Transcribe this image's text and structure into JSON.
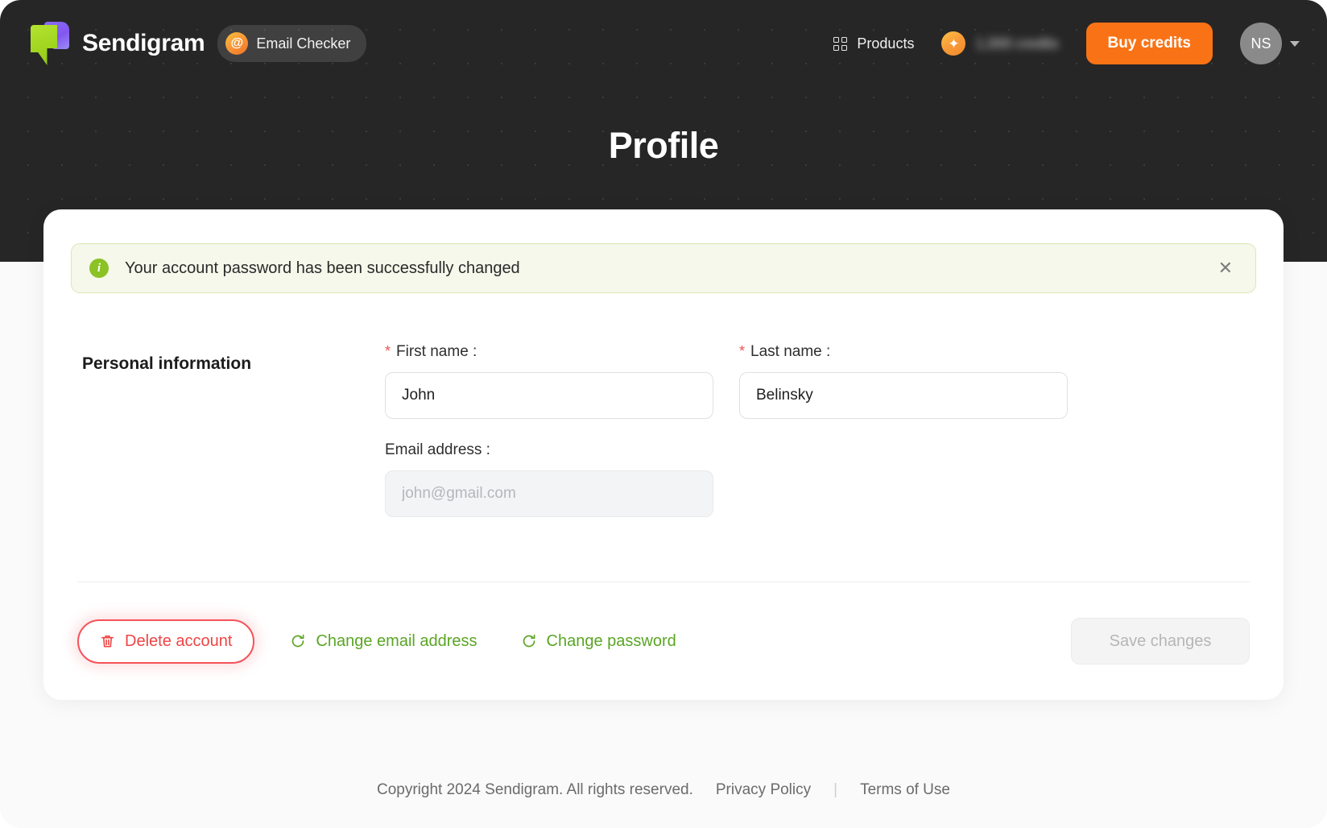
{
  "header": {
    "brand_name": "Sendigram",
    "product_pill": {
      "badge": "@",
      "label": "Email Checker"
    },
    "nav": {
      "products_label": "Products"
    },
    "credits": {
      "amount_label": "1,000 credits"
    },
    "buy_button": "Buy credits",
    "avatar_initials": "NS"
  },
  "page": {
    "title": "Profile"
  },
  "alert": {
    "icon": "i",
    "message": "Your account password has been successfully changed",
    "close": "✕"
  },
  "form": {
    "section_title": "Personal information",
    "first_name": {
      "label": "First name :",
      "required_mark": "*",
      "value": "John"
    },
    "last_name": {
      "label": "Last name :",
      "required_mark": "*",
      "value": "Belinsky"
    },
    "email": {
      "label": "Email address :",
      "placeholder": "john@gmail.com",
      "value": ""
    }
  },
  "actions": {
    "delete_account": "Delete account",
    "change_email": "Change email address",
    "change_password": "Change password",
    "save_changes": "Save changes"
  },
  "footer": {
    "copyright": "Copyright 2024 Sendigram. All rights reserved.",
    "privacy": "Privacy Policy",
    "separator": "|",
    "terms": "Terms of Use"
  },
  "colors": {
    "accent_orange": "#f97316",
    "danger_red": "#ef4444",
    "success_green": "#5aa524",
    "hero_dark": "#262626"
  }
}
